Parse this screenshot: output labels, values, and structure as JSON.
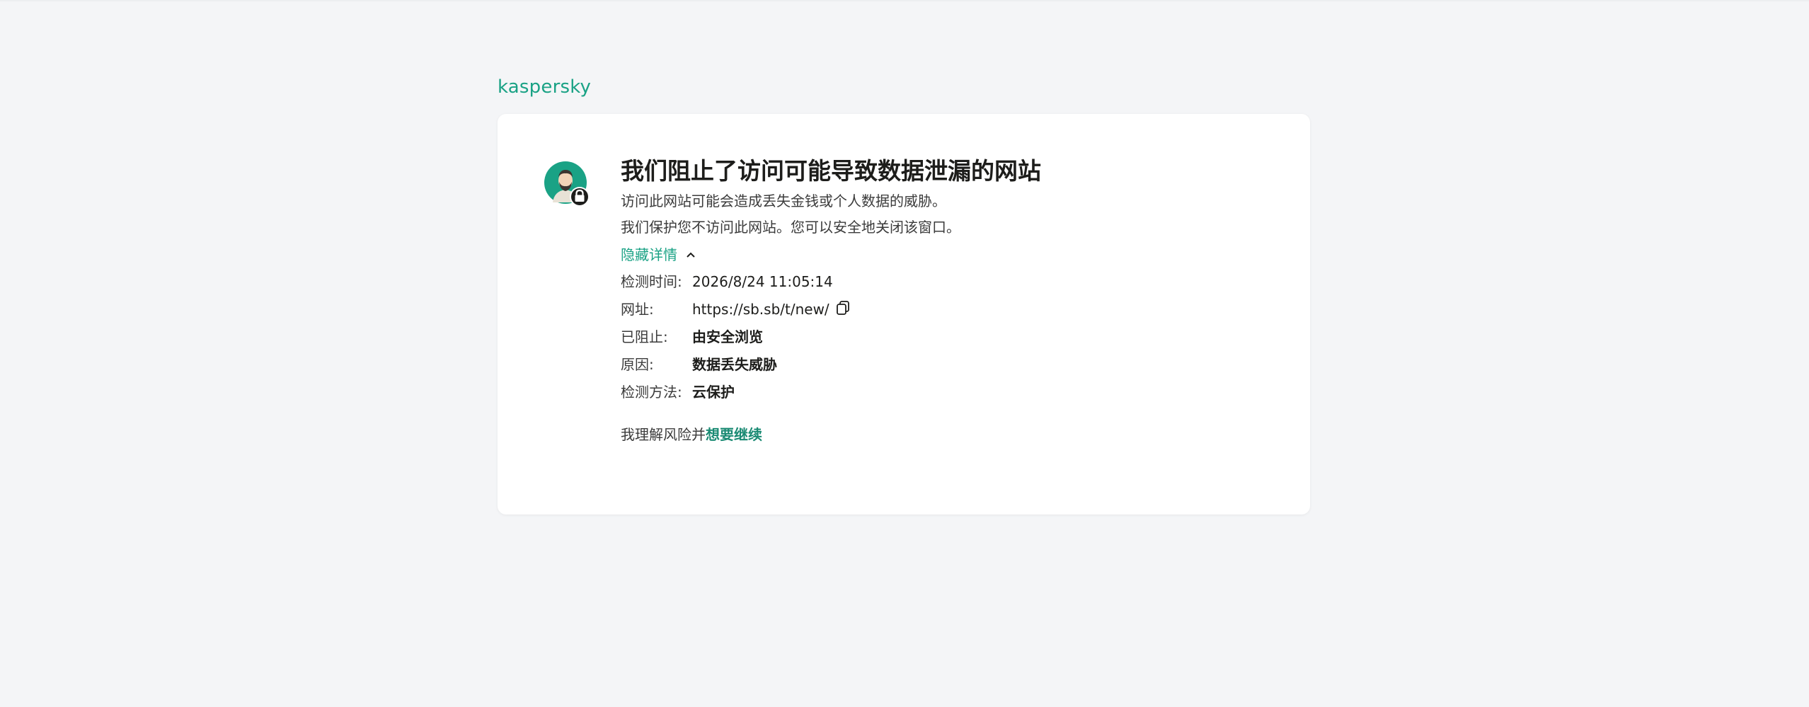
{
  "brand": {
    "logo_text": "kaspersky",
    "color": "#1aa285"
  },
  "card": {
    "title": "我们阻止了访问可能导致数据泄漏的网站",
    "desc_line1": "访问此网站可能会造成丢失金钱或个人数据的威胁。",
    "desc_line2": "我们保护您不访问此网站。您可以安全地关闭该窗口。",
    "toggle_label": "隐藏详情",
    "details": [
      {
        "label": "检测时间:",
        "value": "2026/8/24 11:05:14"
      },
      {
        "label": "网址:",
        "value": "https://sb.sb/t/new/"
      },
      {
        "label": "已阻止:",
        "value": "由安全浏览"
      },
      {
        "label": "原因:",
        "value": "数据丢失威胁"
      },
      {
        "label": "检测方法:",
        "value": "云保护"
      }
    ],
    "proceed_prefix": "我理解风险并",
    "proceed_link": "想要继续"
  },
  "icons": {
    "avatar": "user-avatar-with-lock",
    "toggle": "chevron-up-icon",
    "copy": "copy-icon"
  }
}
